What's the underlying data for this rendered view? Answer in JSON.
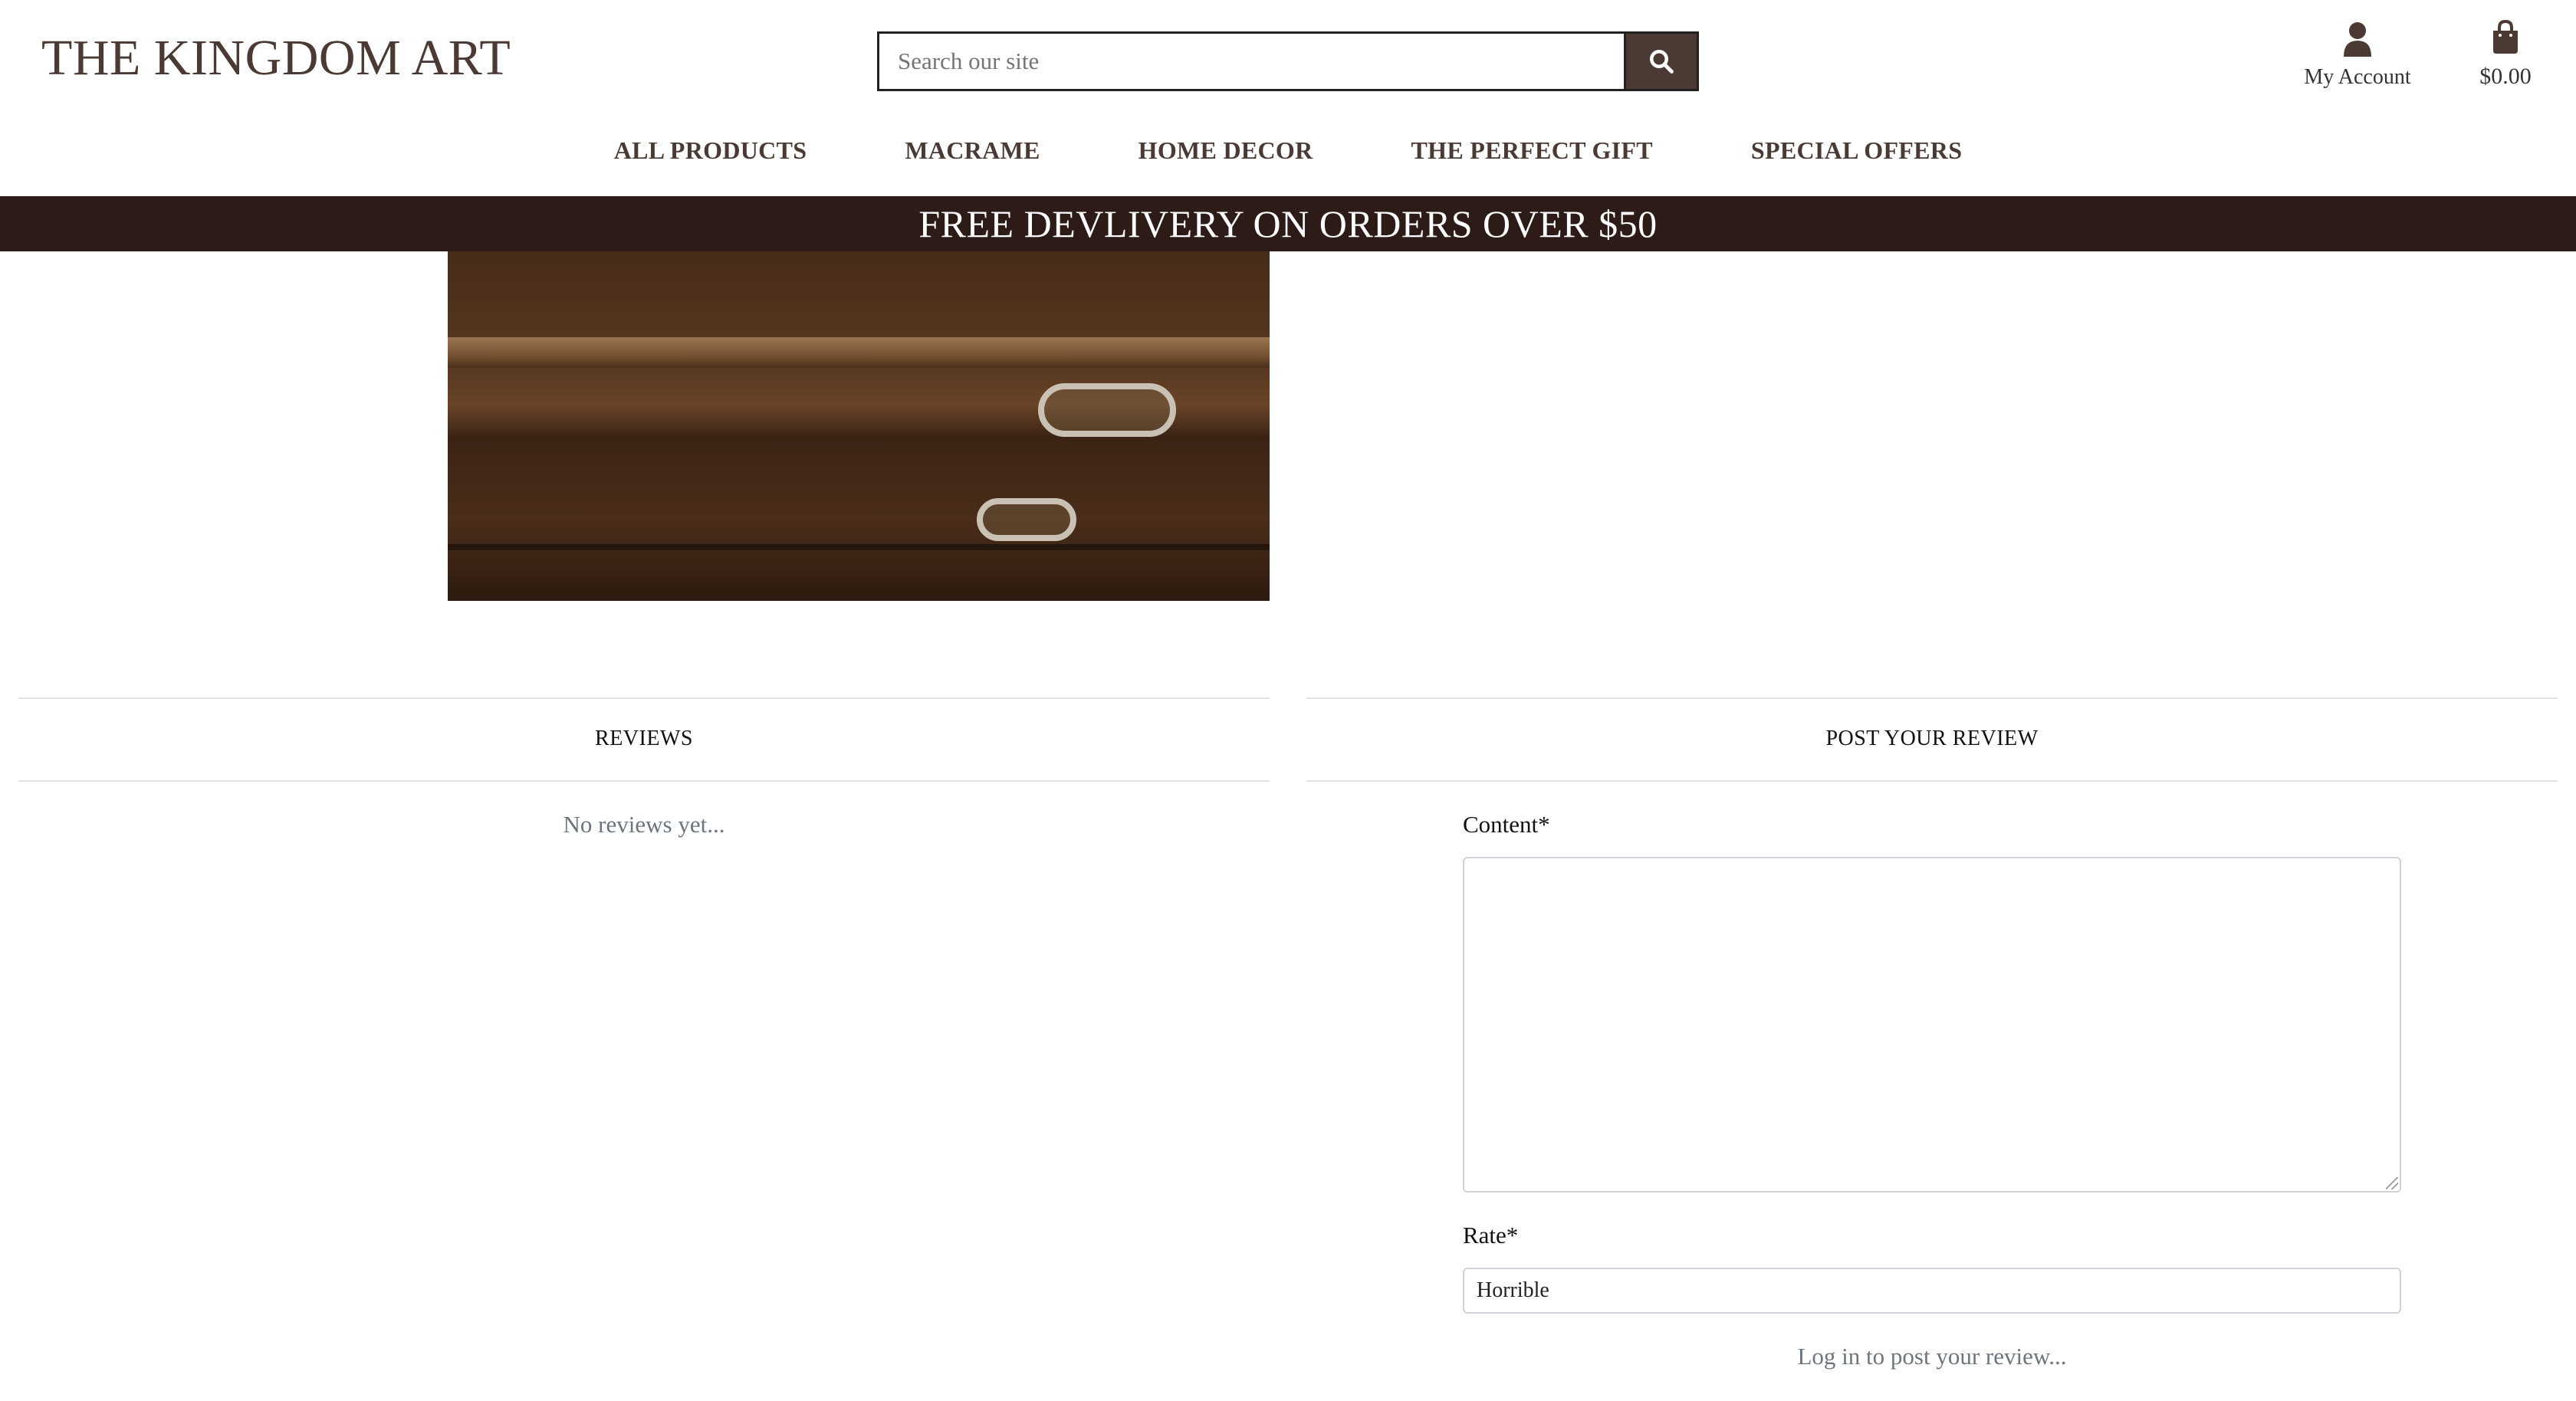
{
  "header": {
    "logo": "THE KINGDOM ART",
    "search": {
      "placeholder": "Search our site",
      "value": ""
    },
    "account": {
      "label": "My Account",
      "icon": "user-icon"
    },
    "bag": {
      "total": "$0.00",
      "icon": "shopping-bag-icon"
    }
  },
  "nav": {
    "items": [
      {
        "label": "ALL PRODUCTS"
      },
      {
        "label": "MACRAME"
      },
      {
        "label": "HOME DECOR"
      },
      {
        "label": "THE PERFECT GIFT"
      },
      {
        "label": "SPECIAL OFFERS"
      }
    ]
  },
  "banner": {
    "text": "FREE DEVLIVERY ON ORDERS OVER $50"
  },
  "reviews": {
    "title": "REVIEWS",
    "empty_text": "No reviews yet..."
  },
  "post_review": {
    "title": "POST YOUR REVIEW",
    "content_label": "Content*",
    "content_value": "",
    "rate_label": "Rate*",
    "rate_value": "Horrible",
    "login_prompt": "Log in to post your review..."
  },
  "colors": {
    "brand": "#4b3a33",
    "banner_bg": "#2d1b18",
    "muted": "#6c757d",
    "rule": "#e2e2e2"
  }
}
